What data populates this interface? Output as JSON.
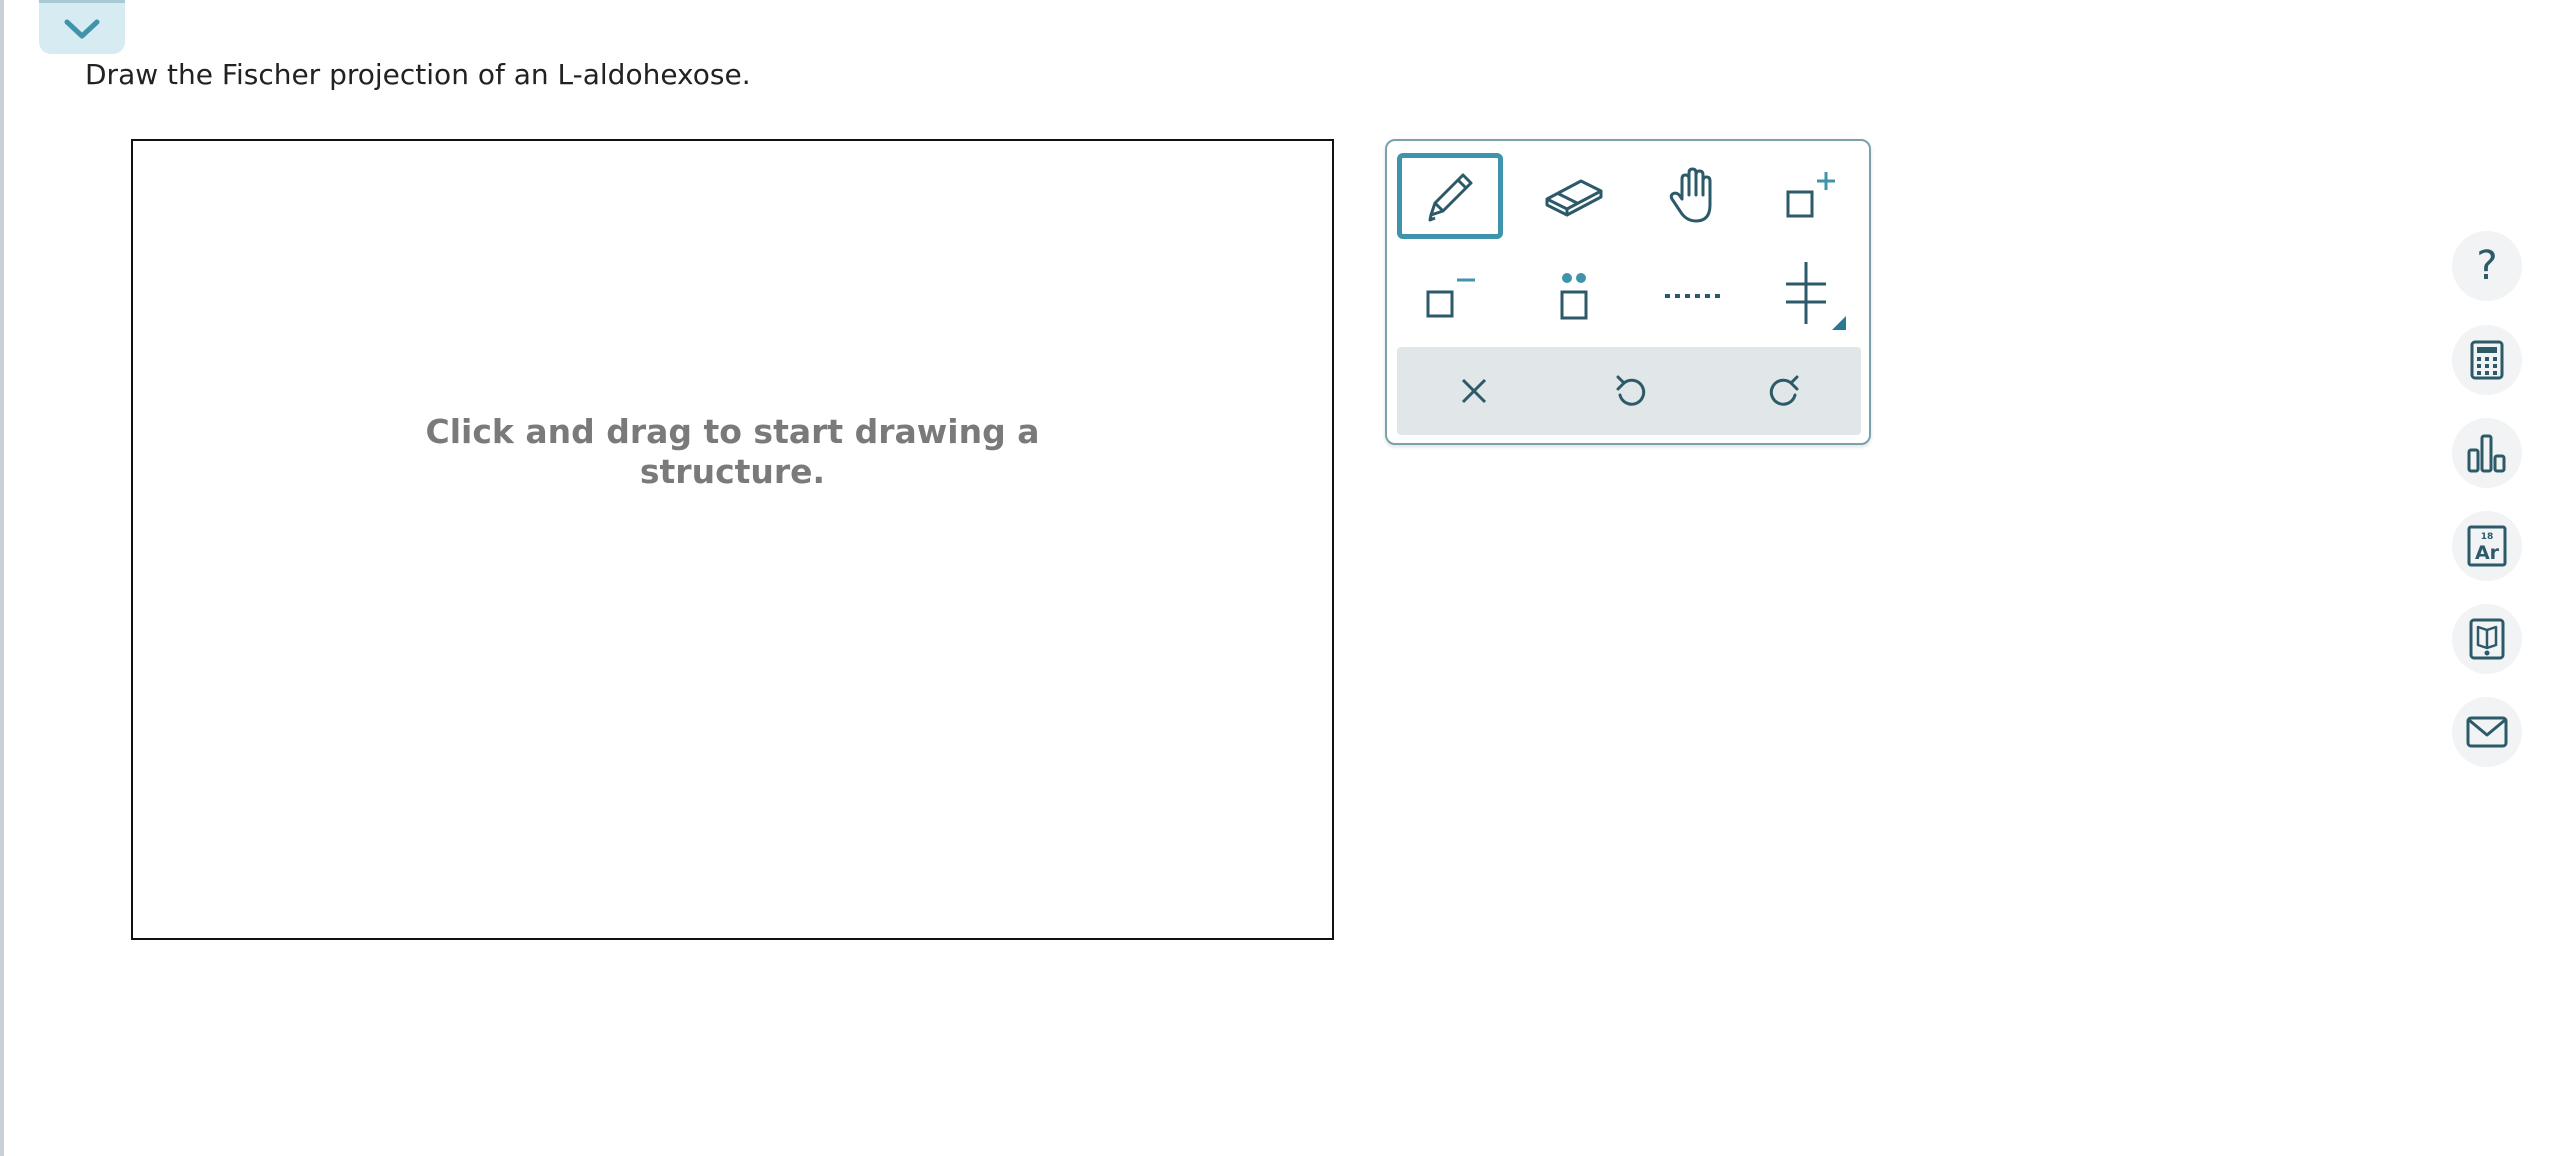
{
  "question": {
    "prompt": "Draw the Fischer projection of an L-aldohexose."
  },
  "collapse_tab": {
    "icon": "chevron-down-icon"
  },
  "canvas": {
    "hint": "Click and drag to start drawing a structure."
  },
  "toolbar": {
    "tools": [
      {
        "name": "pencil",
        "icon": "pencil-icon",
        "selected": true
      },
      {
        "name": "eraser",
        "icon": "eraser-icon",
        "selected": false
      },
      {
        "name": "move",
        "icon": "hand-icon",
        "selected": false
      },
      {
        "name": "positive-charge",
        "icon": "positive-charge-icon",
        "selected": false
      },
      {
        "name": "negative-charge",
        "icon": "negative-charge-icon",
        "selected": false
      },
      {
        "name": "lone-pair",
        "icon": "lone-pair-icon",
        "selected": false
      },
      {
        "name": "dashed-bond",
        "icon": "dashed-bond-icon",
        "selected": false
      },
      {
        "name": "fischer-cross",
        "icon": "fischer-cross-icon",
        "selected": false
      }
    ],
    "actions": [
      {
        "name": "clear",
        "icon": "close-icon"
      },
      {
        "name": "undo",
        "icon": "undo-icon"
      },
      {
        "name": "redo",
        "icon": "redo-icon"
      }
    ]
  },
  "side_panel": {
    "help_label": "?",
    "periodic_mass": "18",
    "periodic_symbol": "Ar",
    "buttons": [
      "help-icon",
      "calculator-icon",
      "bar-chart-icon",
      "periodic-table-icon",
      "ebook-icon",
      "mail-icon"
    ]
  },
  "colors": {
    "accent": "#3f93aa",
    "icon_dark": "#2c5a69",
    "hint_text": "#7a7a7a",
    "toolbar_border": "#7aa2ad",
    "action_bar": "#e1e6e8"
  }
}
